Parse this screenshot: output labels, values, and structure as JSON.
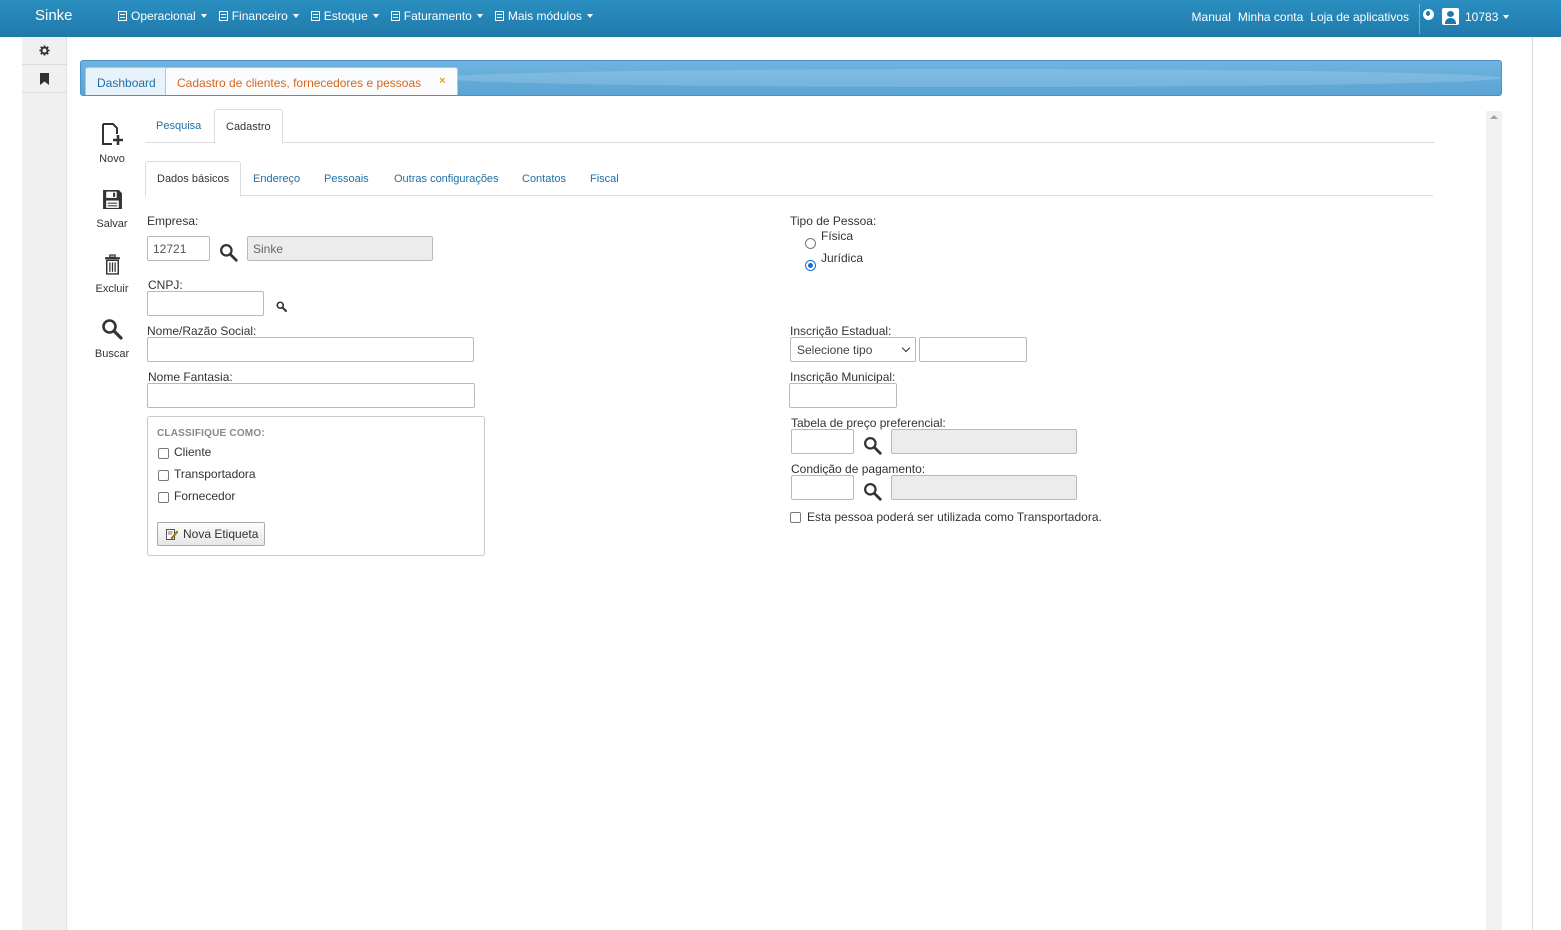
{
  "brand": "Sinke",
  "menu": [
    {
      "label": "Operacional"
    },
    {
      "label": "Financeiro"
    },
    {
      "label": "Estoque"
    },
    {
      "label": "Faturamento"
    },
    {
      "label": "Mais módulos"
    }
  ],
  "right_links": {
    "manual": "Manual",
    "account": "Minha conta",
    "store": "Loja de aplicativos"
  },
  "user": {
    "id": "10783"
  },
  "window_tabs": {
    "dashboard": "Dashboard",
    "active": "Cadastro de clientes, fornecedores e pessoas",
    "close": "×"
  },
  "toolbar": {
    "novo": "Novo",
    "salvar": "Salvar",
    "excluir": "Excluir",
    "buscar": "Buscar"
  },
  "subtabs": {
    "pesquisa": "Pesquisa",
    "cadastro": "Cadastro"
  },
  "form_tabs": {
    "dados": "Dados básicos",
    "endereco": "Endereço",
    "pessoais": "Pessoais",
    "outras": "Outras configurações",
    "contatos": "Contatos",
    "fiscal": "Fiscal"
  },
  "form": {
    "empresa_label": "Empresa:",
    "empresa_code": "12721",
    "empresa_name": "Sinke",
    "cnpj_label": "CNPJ:",
    "cnpj_value": "",
    "nome_label": "Nome/Razão Social:",
    "nome_value": "",
    "fantasia_label": "Nome Fantasia:",
    "fantasia_value": "",
    "classifique_title": "CLASSIFIQUE COMO:",
    "cliente": "Cliente",
    "transportadora": "Transportadora",
    "fornecedor": "Fornecedor",
    "nova_etiqueta": "Nova Etiqueta",
    "tipo_label": "Tipo de Pessoa:",
    "fisica": "Física",
    "juridica": "Jurídica",
    "tipo_selected": "Jurídica",
    "ie_label": "Inscrição Estadual:",
    "ie_select": "Selecione tipo",
    "ie_value": "",
    "im_label": "Inscrição Municipal:",
    "im_value": "",
    "tabela_label": "Tabela de preço preferencial:",
    "tabela_code": "",
    "tabela_name": "",
    "condicao_label": "Condição de pagamento:",
    "condicao_code": "",
    "condicao_name": "",
    "transp_check": "Esta pessoa poderá ser utilizada como Transportadora."
  }
}
